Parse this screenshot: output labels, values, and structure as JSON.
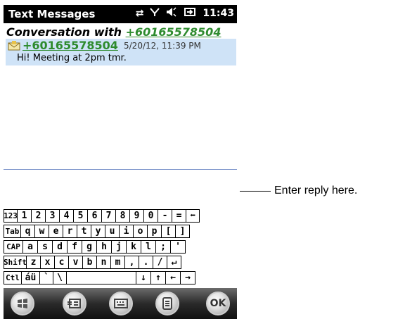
{
  "status_bar": {
    "title": "Text Messages",
    "time": "11:43",
    "icons": [
      "data-sync-icon",
      "signal-icon",
      "speaker-icon",
      "battery-icon"
    ]
  },
  "conversation": {
    "header_prefix": "Conversation with ",
    "contact_number": "+60165578504",
    "message": {
      "sender": "+60165578504",
      "timestamp": "5/20/12, 11:39 PM",
      "text": "Hi! Meeting at 2pm tmr."
    }
  },
  "reply": {
    "placeholder": ""
  },
  "keyboard": {
    "rows": [
      [
        "123",
        "1",
        "2",
        "3",
        "4",
        "5",
        "6",
        "7",
        "8",
        "9",
        "0",
        "-",
        "=",
        "⬅"
      ],
      [
        "Tab",
        "q",
        "w",
        "e",
        "r",
        "t",
        "y",
        "u",
        "i",
        "o",
        "p",
        "[",
        "]"
      ],
      [
        "CAP",
        "a",
        "s",
        "d",
        "f",
        "g",
        "h",
        "j",
        "k",
        "l",
        ";",
        "'"
      ],
      [
        "Shift",
        "z",
        "x",
        "c",
        "v",
        "b",
        "n",
        "m",
        ",",
        ".",
        "/",
        "↵"
      ],
      [
        "Ctl",
        "áü",
        "`",
        "\\",
        " ",
        "↓",
        "↑",
        "←",
        "→"
      ]
    ]
  },
  "bottom_bar": {
    "buttons": [
      {
        "name": "start-button",
        "icon": "windows-logo-icon",
        "label": ""
      },
      {
        "name": "messaging-button",
        "icon": "messaging-icon",
        "label": ""
      },
      {
        "name": "keyboard-button",
        "icon": "keyboard-icon",
        "label": ""
      },
      {
        "name": "menu-button",
        "icon": "menu-icon",
        "label": ""
      },
      {
        "name": "ok-button",
        "icon": "ok-icon",
        "label": "OK"
      }
    ]
  },
  "annotation": {
    "callout": "Enter reply here."
  }
}
